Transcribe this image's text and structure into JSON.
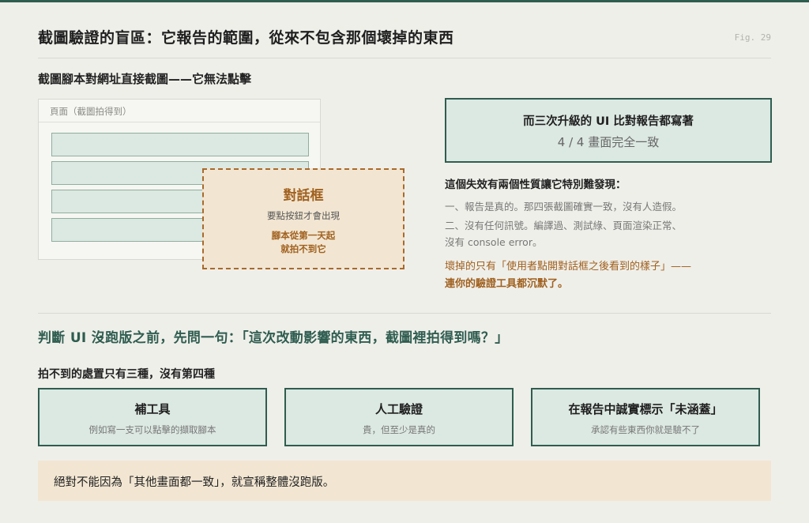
{
  "header": {
    "title": "截圖驗證的盲區：它報告的範圍，從來不包含那個壞掉的東西",
    "fig_label": "Fig. 29"
  },
  "section1": {
    "heading": "截圖腳本對網址直接截圖——它無法點擊"
  },
  "page_mock": {
    "label": "頁面（截圖拍得到）",
    "bar_count": 4
  },
  "dialog": {
    "title": "對話框",
    "subtitle": "要點按鈕才會出現",
    "note_line1": "腳本從第一天起",
    "note_line2": "就拍不到它"
  },
  "report": {
    "line1": "而三次升級的 UI 比對報告都寫著",
    "line2": "4 / 4 畫面完全一致"
  },
  "why": {
    "heading": "這個失效有兩個性質讓它特別難發現：",
    "line1": "一、報告是真的。那四張截圖確實一致，沒有人造假。",
    "line2": "二、沒有任何訊號。編譯過、測試綠、頁面渲染正常、",
    "line3": "沒有 console error。",
    "warn1": "壞掉的只有「使用者點開對話框之後看到的樣子」——",
    "warn2": "連你的驗證工具都沉默了。"
  },
  "question": "判斷 UI 沒跑版之前，先問一句：「這次改動影響的東西，截圖裡拍得到嗎？」",
  "options": {
    "heading": "拍不到的處置只有三種，沒有第四種",
    "items": [
      {
        "title": "補工具",
        "sub": "例如寫一支可以點擊的擷取腳本"
      },
      {
        "title": "人工驗證",
        "sub": "貴，但至少是真的"
      },
      {
        "title": "在報告中誠實標示「未涵蓋」",
        "sub": "承認有些東西你就是驗不了"
      }
    ]
  },
  "final": "絕對不能因為「其他畫面都一致」，就宣稱整體沒跑版。",
  "colors": {
    "accent_green": "#2f5d50",
    "accent_brown": "#a0601e",
    "background": "#efefea"
  }
}
